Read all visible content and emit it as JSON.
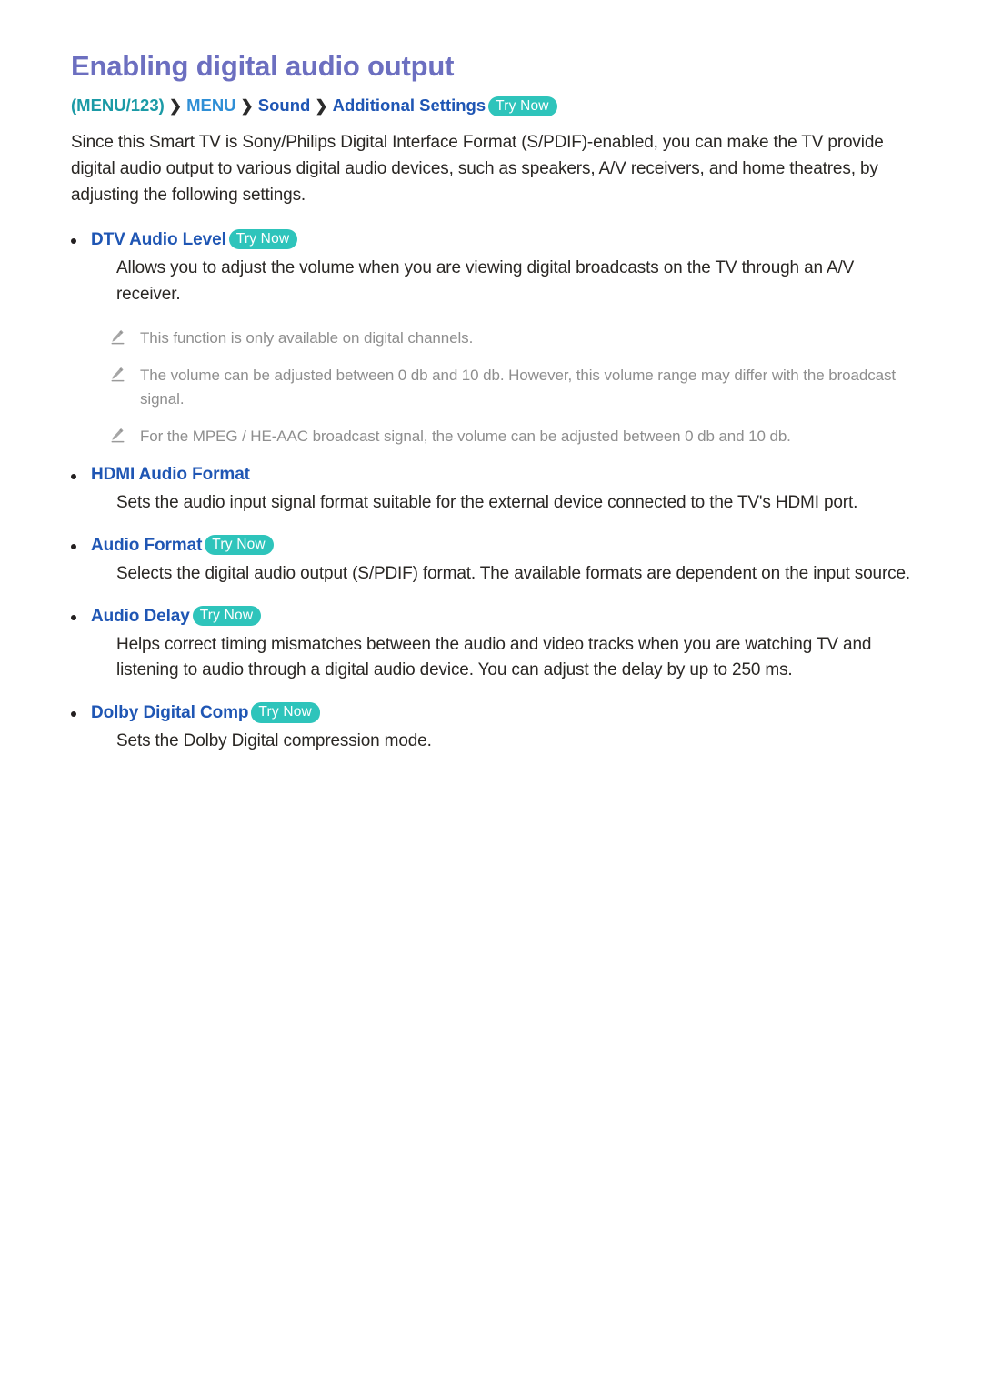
{
  "document": {
    "title": "Enabling digital audio output",
    "breadcrumb": {
      "menu123": "(MENU/123)",
      "separator": "❯",
      "menu": "MENU",
      "sound": "Sound",
      "settings": "Additional Settings",
      "try_now": "Try Now"
    },
    "intro": "Since this Smart TV is Sony/Philips Digital Interface Format (S/PDIF)-enabled, you can make the TV provide digital audio output to various digital audio devices, such as speakers, A/V receivers, and home theatres, by adjusting the following settings.",
    "sections": [
      {
        "label": "DTV Audio Level",
        "try_now": "Try Now",
        "body": "Allows you to adjust the volume when you are viewing digital broadcasts on the TV through an A/V receiver.",
        "notes": [
          "This function is only available on digital channels.",
          "The volume can be adjusted between 0 db and 10 db. However, this volume range may differ with the broadcast signal.",
          "For the MPEG / HE-AAC broadcast signal, the volume can be adjusted between 0 db and 10 db."
        ]
      },
      {
        "label": "HDMI Audio Format",
        "try_now": "",
        "body": "Sets the audio input signal format suitable for the external device connected to the TV's HDMI port.",
        "notes": []
      },
      {
        "label": "Audio Format",
        "try_now": "Try Now",
        "body": "Selects the digital audio output (S/PDIF) format. The available formats are dependent on the input source.",
        "notes": []
      },
      {
        "label": "Audio Delay",
        "try_now": "Try Now",
        "body": "Helps correct timing mismatches between the audio and video tracks when you are watching TV and listening to audio through a digital audio device. You can adjust the delay by up to 250 ms.",
        "notes": []
      },
      {
        "label": "Dolby Digital Comp",
        "try_now": "Try Now",
        "body": "Sets the Dolby Digital compression mode.",
        "notes": []
      }
    ],
    "colors": {
      "title": "#6c6fc0",
      "link_blue": "#1f56b4",
      "menu_blue": "#2f8fd6",
      "menu123_teal": "#1b9aa6",
      "try_now_badge": "#2ec4bb",
      "body_text": "#2a2724",
      "note_text": "#8e8e8e"
    },
    "icons": {
      "pencil": "pencil-icon",
      "bullet": "bullet-dot"
    }
  }
}
